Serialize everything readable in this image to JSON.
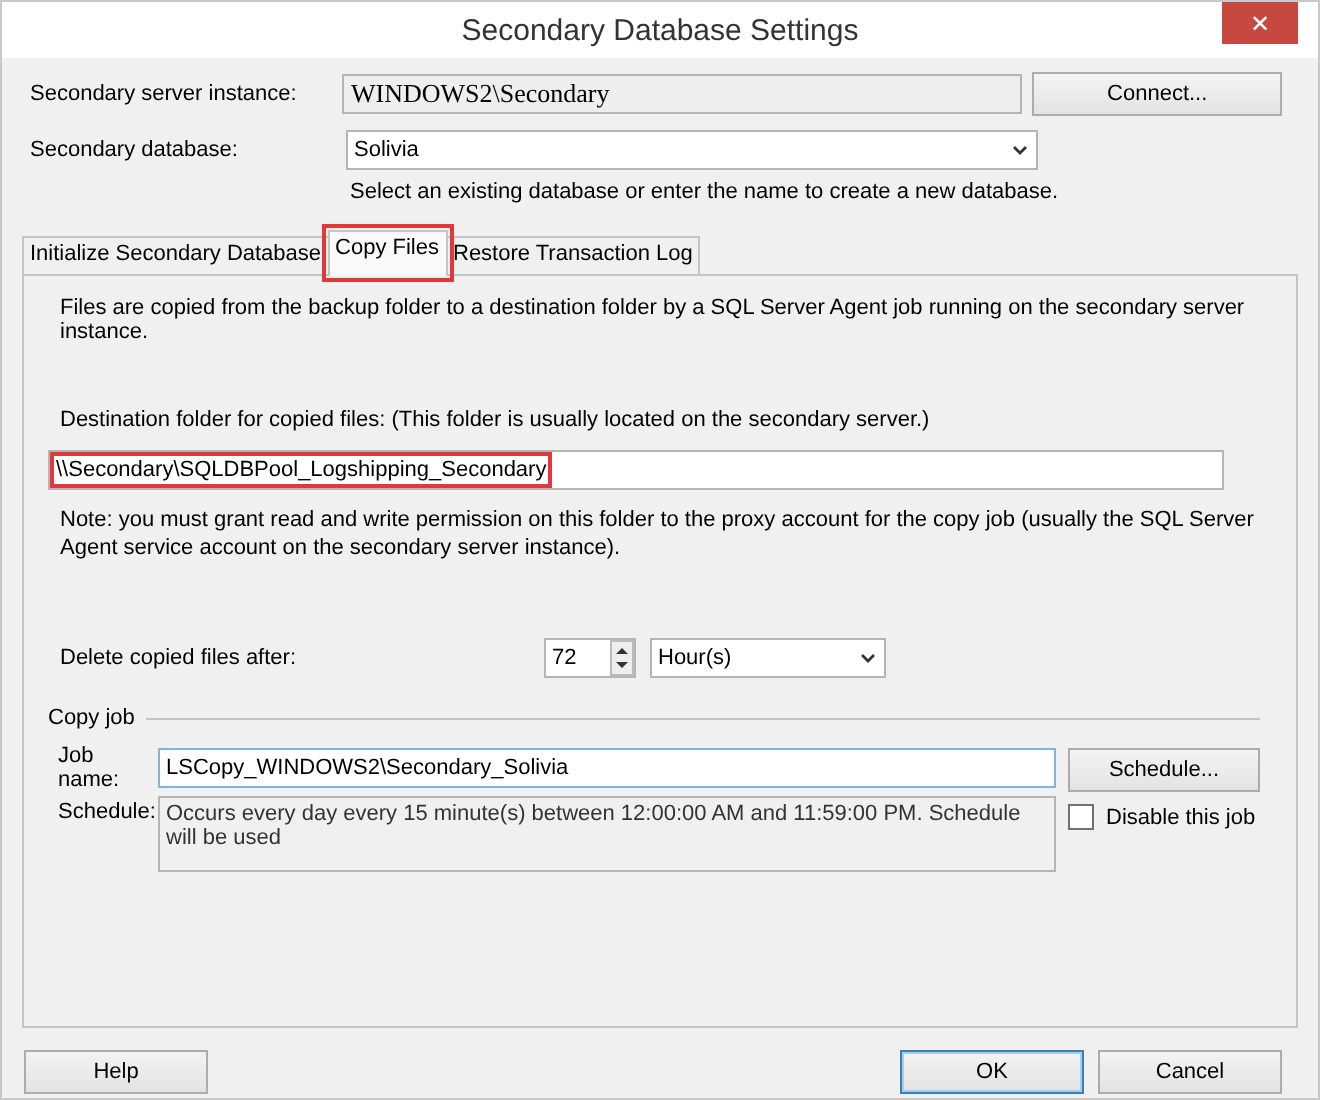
{
  "window": {
    "title": "Secondary Database Settings",
    "close": "✕"
  },
  "server_instance": {
    "label": "Secondary server instance:",
    "value": "WINDOWS2\\Secondary",
    "button": "Connect..."
  },
  "database": {
    "label": "Secondary database:",
    "value": "Solivia",
    "hint": "Select an existing database or enter the name to create a new database."
  },
  "tabs": [
    {
      "label": "Initialize Secondary Database",
      "selected": false,
      "highlighted": false
    },
    {
      "label": "Copy Files",
      "selected": true,
      "highlighted": true
    },
    {
      "label": "Restore Transaction Log",
      "selected": false,
      "highlighted": false
    }
  ],
  "panel": {
    "intro": "Files are copied from the backup folder to a destination folder by a SQL Server Agent job running on the secondary server instance.",
    "destination_label": "Destination folder for copied files: (This folder is usually located on the secondary server.)",
    "destination": {
      "value": "\\\\Secondary\\SQLDBPool_Logshipping_Secondary",
      "highlighted": true
    },
    "note": "Note: you must grant read and write permission on this folder to the proxy account for the copy job (usually the SQL Server Agent service account on the secondary server instance).",
    "delete_label": "Delete copied files after:",
    "delete_value": "72",
    "delete_unit": "Hour(s)",
    "copy_job": {
      "title": "Copy job",
      "job_name_label": "Job name:",
      "job_name": "LSCopy_WINDOWS2\\Secondary_Solivia",
      "schedule_button": "Schedule...",
      "schedule_label": "Schedule:",
      "schedule": "Occurs every day every 15 minute(s) between 12:00:00 AM and 11:59:00 PM. Schedule will be used",
      "disable": {
        "label": "Disable this job",
        "checked": false
      }
    }
  },
  "buttons": [
    {
      "label": "Help",
      "default": false
    },
    {
      "label": "OK",
      "default": true
    },
    {
      "label": "Cancel",
      "default": false
    }
  ]
}
